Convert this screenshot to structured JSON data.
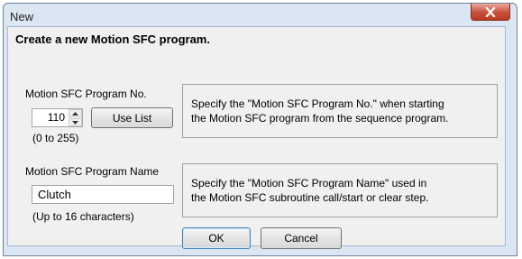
{
  "window": {
    "title": "New",
    "close_icon": "close-icon"
  },
  "dialog": {
    "heading": "Create a new Motion SFC program.",
    "program_no": {
      "label": "Motion SFC Program No.",
      "value": "110",
      "use_list_label": "Use List",
      "range_hint": "(0 to 255)",
      "description_line1": "Specify the \"Motion SFC Program No.\" when starting",
      "description_line2": "the Motion SFC program from the sequence program."
    },
    "program_name": {
      "label": "Motion SFC Program Name",
      "value": "Clutch",
      "length_hint": "(Up to 16 characters)",
      "description_line1": "Specify the \"Motion SFC Program Name\" used in",
      "description_line2": "the Motion SFC subroutine call/start or clear step."
    },
    "ok_label": "OK",
    "cancel_label": "Cancel"
  },
  "colors": {
    "frame": "#dbe6f3",
    "client": "#f0f0f0",
    "close_button": "#c7503a"
  }
}
